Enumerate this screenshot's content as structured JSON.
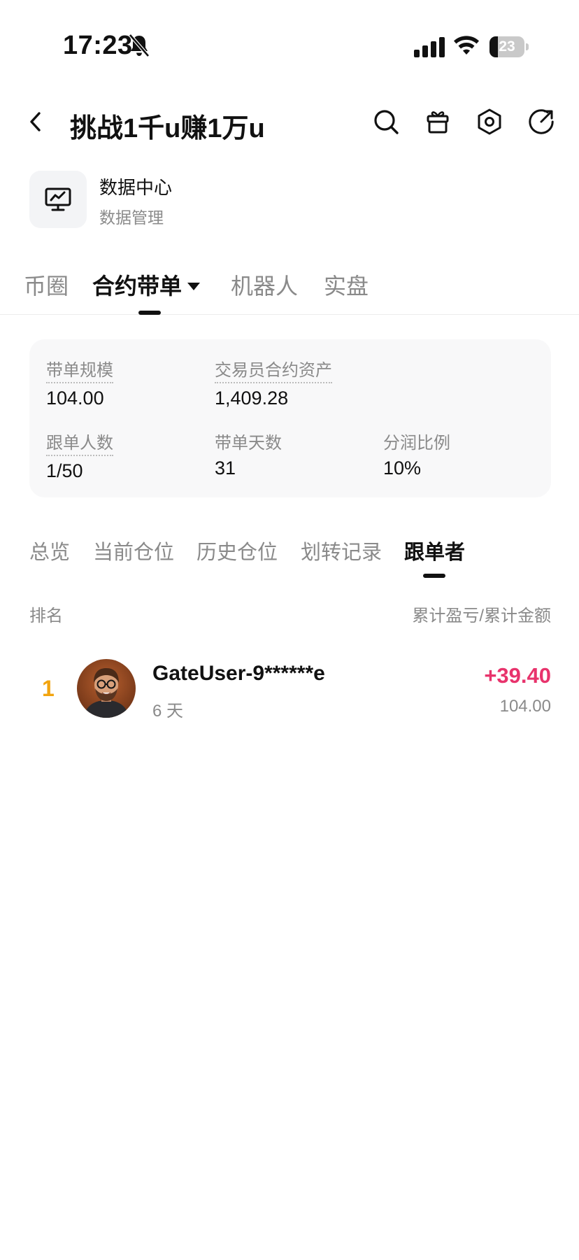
{
  "status_bar": {
    "time": "17:23",
    "battery_level": "23",
    "battery_fraction": 0.23,
    "icons": [
      "bell-muted-icon",
      "signal-icon",
      "wifi-icon",
      "battery-icon"
    ]
  },
  "nav": {
    "title": "挑战1千u赚1万u",
    "icons": [
      "back-icon",
      "search-icon",
      "gift-icon",
      "settings-icon",
      "share-icon"
    ]
  },
  "data_center": {
    "title": "数据中心",
    "subtitle": "数据管理",
    "icon": "monitor-chart-icon"
  },
  "main_tabs": {
    "items": [
      "币圈",
      "合约带单",
      "机器人",
      "实盘"
    ],
    "active": "合约带单"
  },
  "stats": {
    "scale_label": "带单规模",
    "scale_value": "104.00",
    "assets_label": "交易员合约资产",
    "assets_value": "1,409.28",
    "followers_label": "跟单人数",
    "followers_value": "1/50",
    "days_label": "带单天数",
    "days_value": "31",
    "share_label": "分润比例",
    "share_value": "10%"
  },
  "sub_tabs": {
    "items": [
      "总览",
      "当前仓位",
      "历史仓位",
      "划转记录",
      "跟单者"
    ],
    "active": "跟单者"
  },
  "list": {
    "header_left": "排名",
    "header_right": "累计盈亏/累计金额",
    "rows": [
      {
        "rank": "1",
        "name": "GateUser-9******e",
        "days": "6 天",
        "pnl": "+39.40",
        "amount": "104.00"
      }
    ]
  },
  "colors": {
    "accent_pink": "#e8336c",
    "rank_gold": "#f2a40f",
    "muted_text": "#8a8a8a",
    "card_bg": "#f8f8f9"
  }
}
